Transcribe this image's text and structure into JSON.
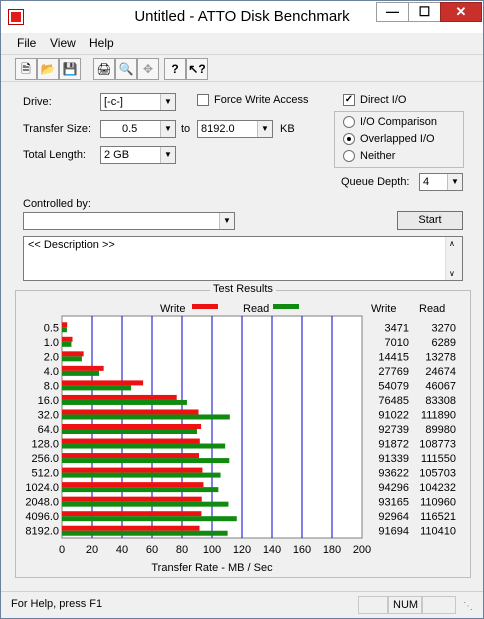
{
  "window": {
    "title": "Untitled - ATTO Disk Benchmark"
  },
  "menu": [
    "File",
    "View",
    "Help"
  ],
  "toolbar": {
    "buttons": [
      "new-icon",
      "open-icon",
      "save-icon",
      "print-icon",
      "print-preview-icon",
      "move-icon",
      "help-icon",
      "context-help-icon"
    ]
  },
  "settings": {
    "drive_label": "Drive:",
    "drive_value": "[-c-]",
    "force_write_label": "Force Write Access",
    "force_write_checked": false,
    "direct_io_label": "Direct I/O",
    "direct_io_checked": true,
    "transfer_size_label": "Transfer Size:",
    "transfer_from": "0.5",
    "to_label": "to",
    "transfer_to": "8192.0",
    "kb_label": "KB",
    "total_length_label": "Total Length:",
    "total_length_value": "2 GB",
    "io_options": [
      "I/O Comparison",
      "Overlapped I/O",
      "Neither"
    ],
    "io_selected": "Overlapped I/O",
    "queue_depth_label": "Queue Depth:",
    "queue_depth_value": "4",
    "controlled_by_label": "Controlled by:",
    "controlled_by_value": "",
    "start_label": "Start",
    "description": "<< Description >>"
  },
  "results": {
    "title": "Test Results",
    "write_legend": "Write",
    "read_legend": "Read",
    "write_col": "Write",
    "read_col": "Read",
    "rows": [
      {
        "size": "0.5",
        "write": "3471",
        "read": "3270"
      },
      {
        "size": "1.0",
        "write": "7010",
        "read": "6289"
      },
      {
        "size": "2.0",
        "write": "14415",
        "read": "13278"
      },
      {
        "size": "4.0",
        "write": "27769",
        "read": "24674"
      },
      {
        "size": "8.0",
        "write": "54079",
        "read": "46067"
      },
      {
        "size": "16.0",
        "write": "76485",
        "read": "83308"
      },
      {
        "size": "32.0",
        "write": "91022",
        "read": "111890"
      },
      {
        "size": "64.0",
        "write": "92739",
        "read": "89980"
      },
      {
        "size": "128.0",
        "write": "91872",
        "read": "108773"
      },
      {
        "size": "256.0",
        "write": "91339",
        "read": "111550"
      },
      {
        "size": "512.0",
        "write": "93622",
        "read": "105703"
      },
      {
        "size": "1024.0",
        "write": "94296",
        "read": "104232"
      },
      {
        "size": "2048.0",
        "write": "93165",
        "read": "110960"
      },
      {
        "size": "4096.0",
        "write": "92964",
        "read": "116521"
      },
      {
        "size": "8192.0",
        "write": "91694",
        "read": "110410"
      }
    ]
  },
  "chart_data": {
    "type": "bar",
    "orientation": "horizontal",
    "title": "Test Results",
    "xlabel": "Transfer Rate - MB / Sec",
    "ylabel": "",
    "xlim": [
      0,
      200
    ],
    "x_ticks": [
      "0",
      "20",
      "40",
      "60",
      "80",
      "100",
      "120",
      "140",
      "160",
      "180",
      "200"
    ],
    "categories": [
      "0.5",
      "1.0",
      "2.0",
      "4.0",
      "8.0",
      "16.0",
      "32.0",
      "64.0",
      "128.0",
      "256.0",
      "512.0",
      "1024.0",
      "2048.0",
      "4096.0",
      "8192.0"
    ],
    "series": [
      {
        "name": "Write",
        "color": "#ee1111",
        "values": [
          3.471,
          7.01,
          14.415,
          27.769,
          54.079,
          76.485,
          91.022,
          92.739,
          91.872,
          91.339,
          93.622,
          94.296,
          93.165,
          92.964,
          91.694
        ]
      },
      {
        "name": "Read",
        "color": "#118a11",
        "values": [
          3.27,
          6.289,
          13.278,
          24.674,
          46.067,
          83.308,
          111.89,
          89.98,
          108.773,
          111.55,
          105.703,
          104.232,
          110.96,
          116.521,
          110.41
        ]
      }
    ],
    "grid": true,
    "grid_color": "#0000cc",
    "legend": "top"
  },
  "status": {
    "help_text": "For Help, press F1",
    "num": "NUM"
  }
}
